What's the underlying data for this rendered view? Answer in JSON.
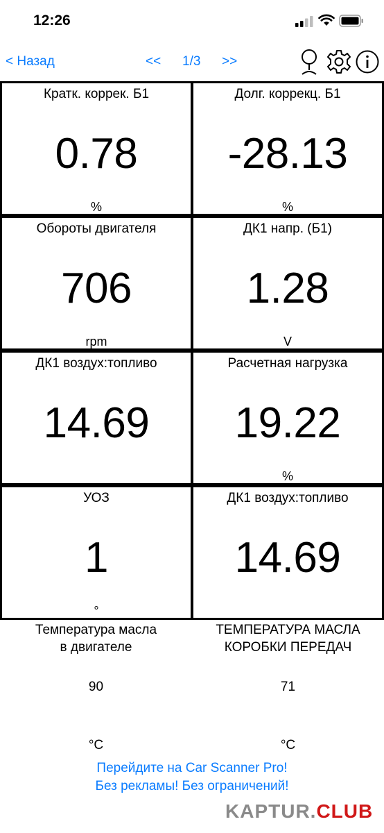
{
  "status": {
    "time": "12:26"
  },
  "nav": {
    "back": "< Назад",
    "prev": "<<",
    "page": "1/3",
    "next": ">>"
  },
  "gauges": [
    {
      "label": "Кратк. коррек. Б1",
      "value": "0.78",
      "unit": "%"
    },
    {
      "label": "Долг. коррекц. Б1",
      "value": "-28.13",
      "unit": "%"
    },
    {
      "label": "Обороты двигателя",
      "value": "706",
      "unit": "rpm"
    },
    {
      "label": "ДК1 напр. (Б1)",
      "value": "1.28",
      "unit": "V"
    },
    {
      "label": "ДК1 воздух:топливо",
      "value": "14.69",
      "unit": ""
    },
    {
      "label": "Расчетная нагрузка",
      "value": "19.22",
      "unit": "%"
    },
    {
      "label": "УОЗ",
      "value": "1",
      "unit": "°"
    },
    {
      "label": "ДК1 воздух:топливо",
      "value": "14.69",
      "unit": ""
    }
  ],
  "bottom": [
    {
      "label_line1": "Температура масла",
      "label_line2": "в двигателе",
      "value": "90",
      "unit": "°C"
    },
    {
      "label_line1": "ТЕМПЕРАТУРА МАСЛА",
      "label_line2": "КОРОБКИ ПЕРЕДАЧ",
      "value": "71",
      "unit": "°C"
    }
  ],
  "promo": {
    "line1": "Перейдите на Car Scanner Pro!",
    "line2": "Без рекламы! Без ограничений!"
  },
  "watermark": {
    "part1": "KAPTUR.",
    "part2": "CLUB"
  },
  "colors": {
    "accent": "#0a7cff",
    "watermark_red": "#d01818"
  }
}
